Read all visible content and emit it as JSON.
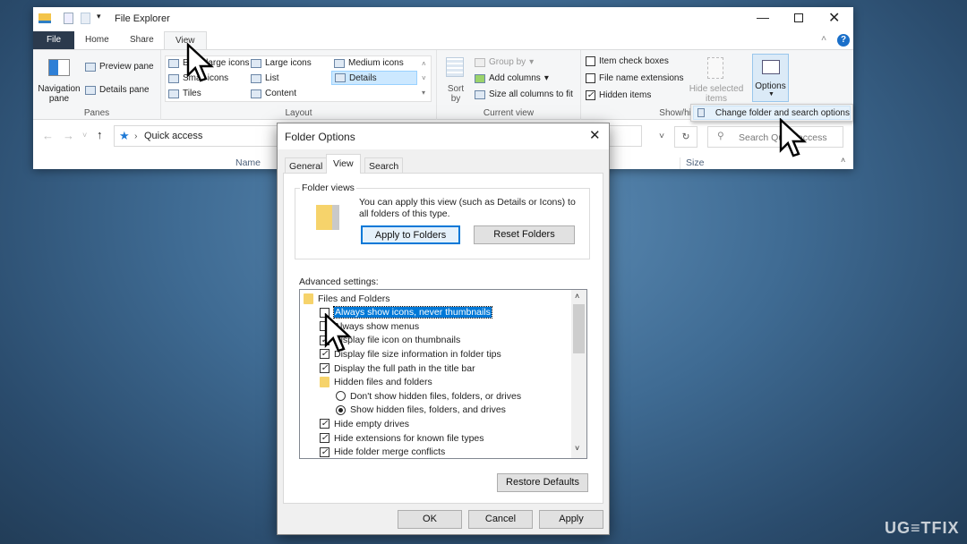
{
  "explorer": {
    "title": "File Explorer",
    "tabs": [
      "File",
      "Home",
      "Share",
      "View"
    ],
    "active_tab": "View",
    "panes": {
      "label": "Panes",
      "navigation_pane": "Navigation pane",
      "preview_pane": "Preview pane",
      "details_pane": "Details pane"
    },
    "layout": {
      "label": "Layout",
      "items": [
        "Extra large icons",
        "Large icons",
        "Medium icons",
        "Small icons",
        "List",
        "Details",
        "Tiles",
        "Content"
      ],
      "selected": "Details"
    },
    "current_view": {
      "label": "Current view",
      "sort_by": "Sort by",
      "group_by": "Group by",
      "add_columns": "Add columns",
      "size_columns": "Size all columns to fit"
    },
    "show_hide": {
      "label": "Show/hide",
      "item_check_boxes": "Item check boxes",
      "file_name_extensions": "File name extensions",
      "hidden_items": "Hidden items",
      "hide_selected": "Hide selected items",
      "checked": {
        "item_check_boxes": false,
        "file_name_extensions": false,
        "hidden_items": true
      }
    },
    "options_label": "Options",
    "options_menu_item": "Change folder and search options",
    "address": "Quick access",
    "search_placeholder": "Search Quick access",
    "columns": [
      "Name",
      "Size"
    ]
  },
  "dialog": {
    "title": "Folder Options",
    "tabs": [
      "General",
      "View",
      "Search"
    ],
    "active_tab": "View",
    "folder_views_label": "Folder views",
    "folder_views_text": "You can apply this view (such as Details or Icons) to all folders of this type.",
    "apply_to_folders": "Apply to Folders",
    "reset_folders": "Reset Folders",
    "advanced_label": "Advanced settings:",
    "items": [
      {
        "type": "folder",
        "label": "Files and Folders"
      },
      {
        "type": "check",
        "label": "Always show icons, never thumbnails",
        "checked": false,
        "selected": true
      },
      {
        "type": "check",
        "label": "Always show menus",
        "checked": false
      },
      {
        "type": "check",
        "label": "Display file icon on thumbnails",
        "checked": true
      },
      {
        "type": "check",
        "label": "Display file size information in folder tips",
        "checked": true
      },
      {
        "type": "check",
        "label": "Display the full path in the title bar",
        "checked": true
      },
      {
        "type": "subfolder",
        "label": "Hidden files and folders"
      },
      {
        "type": "radio",
        "label": "Don't show hidden files, folders, or drives",
        "checked": false
      },
      {
        "type": "radio",
        "label": "Show hidden files, folders, and drives",
        "checked": true
      },
      {
        "type": "check",
        "label": "Hide empty drives",
        "checked": true
      },
      {
        "type": "check",
        "label": "Hide extensions for known file types",
        "checked": true
      },
      {
        "type": "check",
        "label": "Hide folder merge conflicts",
        "checked": true
      }
    ],
    "restore_defaults": "Restore Defaults",
    "ok": "OK",
    "cancel": "Cancel",
    "apply": "Apply"
  },
  "watermark": "UG≡TFIX",
  "colors": {
    "accent": "#0078d7",
    "selection": "#cce8ff",
    "file_tab": "#2b579a"
  }
}
